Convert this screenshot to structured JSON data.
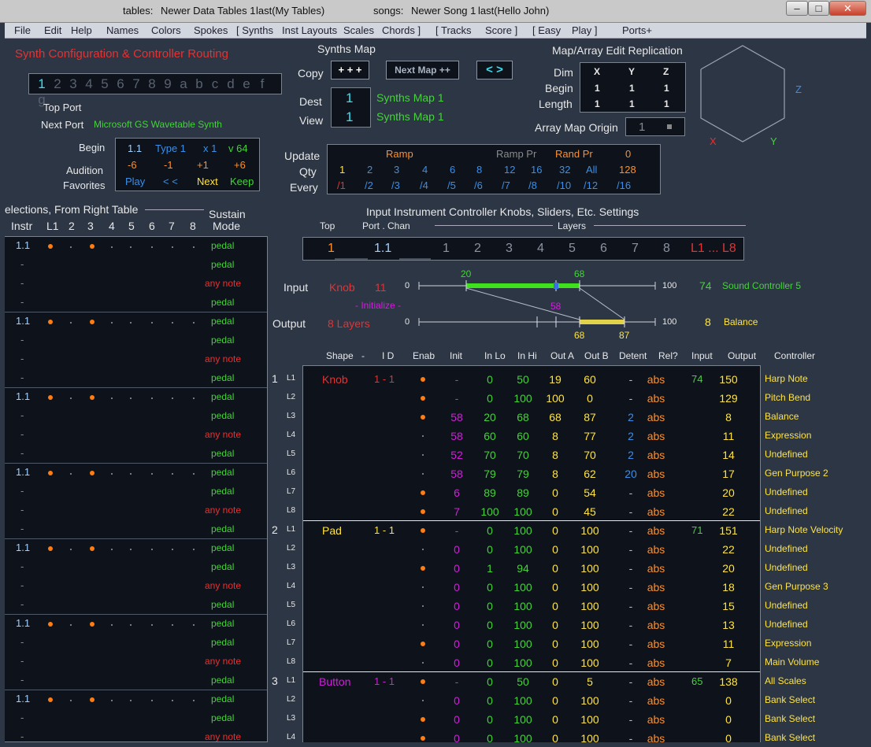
{
  "titlebar": {
    "tables_label": "tables:",
    "tables_value": "Newer Data Tables 1",
    "tables_last": "last(My Tables)",
    "songs_label": "songs:",
    "songs_value": "Newer Song 1",
    "songs_last": "last(Hello John)",
    "minimize": "–",
    "maximize": "□",
    "close": "✕"
  },
  "menu": [
    "File",
    "Edit",
    "Help",
    "Names",
    "Colors",
    "Spokes",
    "[  Synths",
    "Inst Layouts",
    "Scales",
    "Chords  ]",
    "[  Tracks",
    "Score  ]",
    "[  Easy",
    "Play  ]",
    "Ports+"
  ],
  "synth": {
    "title": "Synth Configuration & Controller Routing",
    "channels": [
      "1",
      "2",
      "3",
      "4",
      "5",
      "6",
      "7",
      "8",
      "9",
      "a",
      "b",
      "c",
      "d",
      "e",
      "f",
      "g"
    ],
    "top_port_label": "Top Port",
    "next_port_label": "Next Port",
    "next_port_value": "Microsoft GS Wavetable Synth",
    "begin_label": "Begin",
    "audition_label": "Audition",
    "favorites_label": "Favorites",
    "begin_row": [
      "1.1",
      "Type 1",
      "x 1",
      "v 64"
    ],
    "audition_row": [
      "-6",
      "-1",
      "+1",
      "+6"
    ],
    "favorites_row": [
      "Play",
      "< <",
      "Next",
      "Keep"
    ]
  },
  "synths_map": {
    "title": "Synths Map",
    "copy_label": "Copy",
    "copy_btn": "+   + +",
    "next_map_btn": "Next Map ++",
    "arrows_btn": "<  >",
    "dest_label": "Dest",
    "view_label": "View",
    "dest_value": "1",
    "view_value": "1",
    "dest_name": "Synths Map 1",
    "view_name": "Synths Map 1"
  },
  "replication": {
    "title": "Map/Array Edit Replication",
    "dim_label": "Dim",
    "begin_label": "Begin",
    "length_label": "Length",
    "headers": [
      "X",
      "Y",
      "Z"
    ],
    "begin": [
      "1",
      "1",
      "1"
    ],
    "length": [
      "1",
      "1",
      "1"
    ],
    "origin_label": "Array Map Origin",
    "origin_value": "1",
    "axis_x": "X",
    "axis_y": "Y",
    "axis_z": "Z"
  },
  "update": {
    "update_label": "Update",
    "qty_label": "Qty",
    "every_label": "Every",
    "ramp": "Ramp",
    "ramp_pr": "Ramp Pr",
    "rand_pr": "Rand Pr",
    "rand_val": "0",
    "qty": [
      "1",
      "2",
      "3",
      "4",
      "6",
      "8",
      "12",
      "16",
      "32",
      "All",
      "128"
    ],
    "every": [
      "/1",
      "/2",
      "/3",
      "/4",
      "/5",
      "/6",
      "/7",
      "/8",
      "/10",
      "/12",
      "/16"
    ]
  },
  "left_table": {
    "title": "elections, From Right Table",
    "sustain_label": "Sustain",
    "headers": [
      "Instr",
      "L1",
      "2",
      "3",
      "4",
      "5",
      "6",
      "7",
      "8",
      "Mode"
    ],
    "groups": 7,
    "instr": "1.1",
    "dash": "-",
    "modes": [
      "pedal",
      "pedal",
      "any note",
      "pedal"
    ]
  },
  "input_settings": {
    "title": "Input Instrument Controller Knobs, Sliders, Etc. Settings",
    "top_label": "Top",
    "port_chan_label": "Port . Chan",
    "layers_label": "Layers",
    "top_value": "1",
    "port_chan_value": "1.1",
    "layers": [
      "1",
      "2",
      "3",
      "4",
      "5",
      "6",
      "7",
      "8"
    ],
    "all_layers": "L1 ... L8"
  },
  "mapping": {
    "input_label": "Input",
    "output_label": "Output",
    "input_type": "Knob",
    "input_num": "11",
    "initialize": "- Initialize -",
    "init_value": "58",
    "output_type": "8 Layers",
    "scale_min": "0",
    "scale_max": "100",
    "in_lo": "20",
    "in_hi": "68",
    "in_pos": 0.58,
    "out_a": "68",
    "out_b": "87",
    "input_value": "74",
    "input_name": "Sound Controller 5",
    "output_value": "8",
    "output_name": "Balance"
  },
  "ctrl_table": {
    "headers": [
      "Shape",
      "-",
      "I D",
      "Enab",
      "Init",
      "In Lo",
      "In Hi",
      "Out A",
      "Out B",
      "Detent",
      "Rel?",
      "Input",
      "Output",
      "Controller"
    ],
    "groups": [
      {
        "num": "1",
        "shape": "Knob",
        "shape_color": "#e53232",
        "id": "1 - 1",
        "input": "74",
        "rows": [
          {
            "l": "L1",
            "en": "dot",
            "init": "-",
            "lo": "0",
            "hi": "50",
            "a": "19",
            "b": "60",
            "det": "-",
            "rel": "abs",
            "out": "150",
            "ctrl": "Harp Note"
          },
          {
            "l": "L2",
            "en": "dot",
            "init": "-",
            "lo": "0",
            "hi": "100",
            "a": "100",
            "b": "0",
            "det": "-",
            "rel": "abs",
            "out": "129",
            "ctrl": "Pitch Bend"
          },
          {
            "l": "L3",
            "en": "dot",
            "init": "58",
            "lo": "20",
            "hi": "68",
            "a": "68",
            "b": "87",
            "det": "2",
            "rel": "abs",
            "out": "8",
            "ctrl": "Balance"
          },
          {
            "l": "L4",
            "en": "sdot",
            "init": "58",
            "lo": "60",
            "hi": "60",
            "a": "8",
            "b": "77",
            "det": "2",
            "rel": "abs",
            "out": "11",
            "ctrl": "Expression"
          },
          {
            "l": "L5",
            "en": "sdot",
            "init": "52",
            "lo": "70",
            "hi": "70",
            "a": "8",
            "b": "70",
            "det": "2",
            "rel": "abs",
            "out": "14",
            "ctrl": "Undefined"
          },
          {
            "l": "L6",
            "en": "sdot",
            "init": "58",
            "lo": "79",
            "hi": "79",
            "a": "8",
            "b": "62",
            "det": "20",
            "rel": "abs",
            "out": "17",
            "ctrl": "Gen Purpose 2"
          },
          {
            "l": "L7",
            "en": "dot",
            "init": "6",
            "lo": "89",
            "hi": "89",
            "a": "0",
            "b": "54",
            "det": "-",
            "rel": "abs",
            "out": "20",
            "ctrl": "Undefined"
          },
          {
            "l": "L8",
            "en": "dot",
            "init": "7",
            "lo": "100",
            "hi": "100",
            "a": "0",
            "b": "45",
            "det": "-",
            "rel": "abs",
            "out": "22",
            "ctrl": "Undefined"
          }
        ]
      },
      {
        "num": "2",
        "shape": "Pad",
        "shape_color": "#ffe340",
        "id": "1 - 1",
        "input": "71",
        "rows": [
          {
            "l": "L1",
            "en": "dot",
            "init": "-",
            "lo": "0",
            "hi": "100",
            "a": "0",
            "b": "100",
            "det": "-",
            "rel": "abs",
            "out": "151",
            "ctrl": "Harp Note Velocity"
          },
          {
            "l": "L2",
            "en": "sdot",
            "init": "0",
            "lo": "0",
            "hi": "100",
            "a": "0",
            "b": "100",
            "det": "-",
            "rel": "abs",
            "out": "22",
            "ctrl": "Undefined"
          },
          {
            "l": "L3",
            "en": "dot",
            "init": "0",
            "lo": "1",
            "hi": "94",
            "a": "0",
            "b": "100",
            "det": "-",
            "rel": "abs",
            "out": "20",
            "ctrl": "Undefined"
          },
          {
            "l": "L4",
            "en": "sdot",
            "init": "0",
            "lo": "0",
            "hi": "100",
            "a": "0",
            "b": "100",
            "det": "-",
            "rel": "abs",
            "out": "18",
            "ctrl": "Gen Purpose 3"
          },
          {
            "l": "L5",
            "en": "sdot",
            "init": "0",
            "lo": "0",
            "hi": "100",
            "a": "0",
            "b": "100",
            "det": "-",
            "rel": "abs",
            "out": "15",
            "ctrl": "Undefined"
          },
          {
            "l": "L6",
            "en": "sdot",
            "init": "0",
            "lo": "0",
            "hi": "100",
            "a": "0",
            "b": "100",
            "det": "-",
            "rel": "abs",
            "out": "13",
            "ctrl": "Undefined"
          },
          {
            "l": "L7",
            "en": "dot",
            "init": "0",
            "lo": "0",
            "hi": "100",
            "a": "0",
            "b": "100",
            "det": "-",
            "rel": "abs",
            "out": "11",
            "ctrl": "Expression"
          },
          {
            "l": "L8",
            "en": "sdot",
            "init": "0",
            "lo": "0",
            "hi": "100",
            "a": "0",
            "b": "100",
            "det": "-",
            "rel": "abs",
            "out": "7",
            "ctrl": "Main Volume"
          }
        ]
      },
      {
        "num": "3",
        "shape": "Button",
        "shape_color": "#d020d8",
        "id": "1 - 1",
        "input": "65",
        "rows": [
          {
            "l": "L1",
            "en": "dot",
            "init": "-",
            "lo": "0",
            "hi": "50",
            "a": "0",
            "b": "5",
            "det": "-",
            "rel": "abs",
            "out": "138",
            "ctrl": "All Scales"
          },
          {
            "l": "L2",
            "en": "sdot",
            "init": "0",
            "lo": "0",
            "hi": "100",
            "a": "0",
            "b": "100",
            "det": "-",
            "rel": "abs",
            "out": "0",
            "ctrl": "Bank Select"
          },
          {
            "l": "L3",
            "en": "dot",
            "init": "0",
            "lo": "0",
            "hi": "100",
            "a": "0",
            "b": "100",
            "det": "-",
            "rel": "abs",
            "out": "0",
            "ctrl": "Bank Select"
          },
          {
            "l": "L4",
            "en": "dot",
            "init": "0",
            "lo": "0",
            "hi": "100",
            "a": "0",
            "b": "100",
            "det": "-",
            "rel": "abs",
            "out": "0",
            "ctrl": "Bank Select"
          }
        ]
      }
    ]
  },
  "colors": {
    "orange": "#ff8f28",
    "green": "#46d23a",
    "blue": "#3b8fe6",
    "yellow": "#ffe340",
    "red": "#e53232",
    "magenta": "#d020d8",
    "cyan": "#38e0f0"
  }
}
